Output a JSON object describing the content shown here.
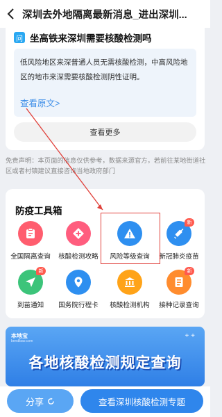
{
  "header": {
    "title": "深圳去外地隔离最新消息_进出深圳..."
  },
  "qa": {
    "badge": "问",
    "question": "坐高铁来深圳需要核酸检测吗",
    "answer": "低风险地区来深普通人员无需核酸检测，中高风险地区的地市来深需要核酸检测阴性证明。",
    "view_original": "查看原文>",
    "more_button": "查看更多"
  },
  "disclaimer": "免责声明：本页面的信息仅供参考，数据来源官方，若前往某地街道社区或者村镇建议直接咨询当地政府部门",
  "tools": {
    "title": "防疫工具箱",
    "items": [
      {
        "label": "全国隔离查询",
        "icon": "clipboard-icon",
        "color": "#ff5d6e",
        "badge": ""
      },
      {
        "label": "核酸检测攻略",
        "icon": "medical-plus-icon",
        "color": "#ff5d7e",
        "badge": ""
      },
      {
        "label": "风险等级查询",
        "icon": "warning-icon",
        "color": "#2e8ff0",
        "badge": ""
      },
      {
        "label": "新冠肺炎疫苗",
        "icon": "syringe-icon",
        "color": "#2e8ff0",
        "badge": "新"
      },
      {
        "label": "到苗通知",
        "icon": "send-icon",
        "color": "#3cc47a",
        "badge": "新"
      },
      {
        "label": "国务院行程卡",
        "icon": "location-pin-icon",
        "color": "#2e8ff0",
        "badge": ""
      },
      {
        "label": "核酸检测机构",
        "icon": "institution-icon",
        "color": "#ffa318",
        "badge": ""
      },
      {
        "label": "接种记录查询",
        "icon": "record-icon",
        "color": "#ff8c2e",
        "badge": "新"
      }
    ]
  },
  "banner": {
    "brand": "本地宝",
    "brand_sub": "bendibao.com",
    "text": "各地核酸检测规定查询"
  },
  "bottom": {
    "share": "分享",
    "view": "查看深圳核酸检测专题"
  }
}
